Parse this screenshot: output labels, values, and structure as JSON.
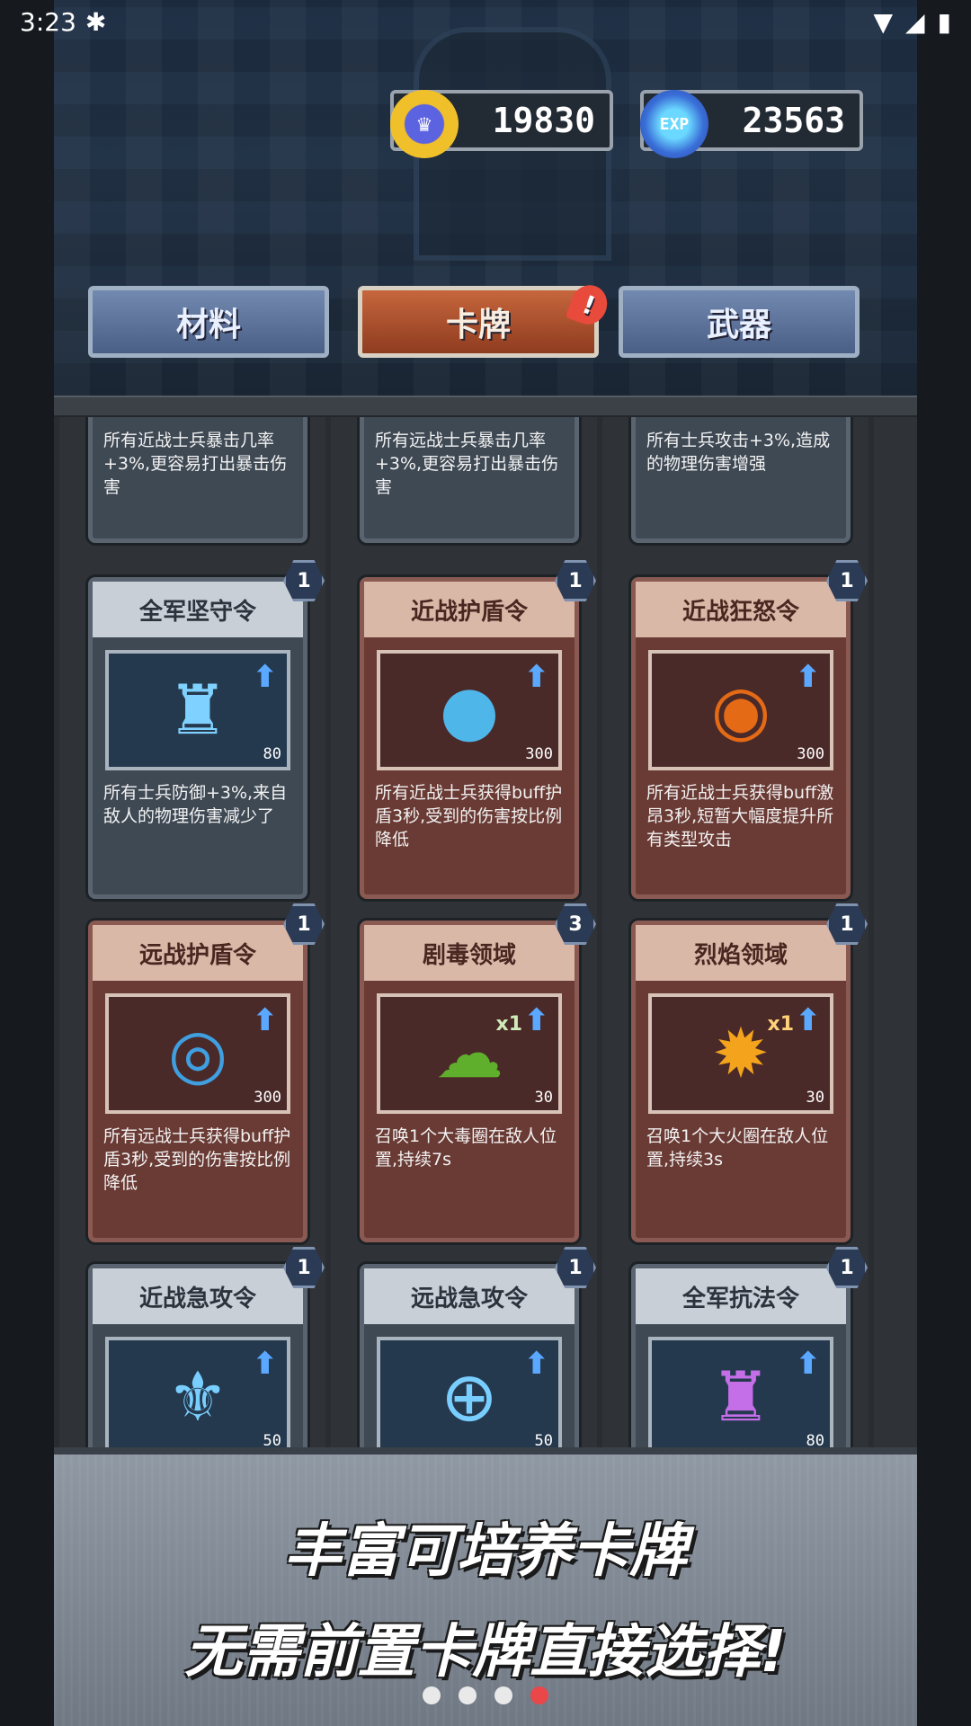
{
  "status_bar": {
    "time": "3:23",
    "app_icon": "bug-icon",
    "wifi": "wifi-icon",
    "signal": "signal-icon",
    "battery": "battery-charging-icon"
  },
  "currency": {
    "gold": {
      "icon": "crown-coin-icon",
      "value": "19830"
    },
    "exp": {
      "icon": "exp-gem-icon",
      "icon_text": "EXP",
      "value": "23563"
    }
  },
  "tabs": [
    {
      "label": "材料",
      "active": false
    },
    {
      "label": "卡牌",
      "active": true,
      "badge": "!"
    },
    {
      "label": "武器",
      "active": false
    }
  ],
  "partial_cards": [
    {
      "desc": "所有近战士兵暴击几率+3%,更容易打出暴击伤害"
    },
    {
      "desc": "所有远战士兵暴击几率+3%,更容易打出暴击伤害"
    },
    {
      "desc": "所有士兵攻击+3%,造成的物理伤害增强"
    }
  ],
  "cards": [
    {
      "title": "全军坚守令",
      "level": "1",
      "power": "80",
      "desc": "所有士兵防御+3%,来自敌人的物理伤害减少了",
      "icon": "soldier-shield-icon",
      "style": "blue"
    },
    {
      "title": "近战护盾令",
      "level": "1",
      "power": "300",
      "desc": "所有近战士兵获得buff护盾3秒,受到的伤害按比例降低",
      "icon": "shield-orb-icon",
      "style": "brown"
    },
    {
      "title": "近战狂怒令",
      "level": "1",
      "power": "300",
      "desc": "所有近战士兵获得buff激昂3秒,短暂大幅度提升所有类型攻击",
      "icon": "rage-arrows-icon",
      "style": "brown"
    },
    {
      "title": "远战护盾令",
      "level": "1",
      "power": "300",
      "desc": "所有远战士兵获得buff护盾3秒,受到的伤害按比例降低",
      "icon": "target-shield-icon",
      "style": "brown"
    },
    {
      "title": "剧毒领域",
      "level": "3",
      "power": "30",
      "mult": "x1",
      "desc": "召唤1个大毒圈在敌人位置,持续7s",
      "icon": "poison-cloud-icon",
      "style": "brown"
    },
    {
      "title": "烈焰领域",
      "level": "1",
      "power": "30",
      "mult": "x1",
      "desc": "召唤1个大火圈在敌人位置,持续3s",
      "icon": "fire-burst-icon",
      "style": "brown"
    },
    {
      "title": "近战急攻令",
      "level": "1",
      "power": "50",
      "desc": "",
      "icon": "wing-badge-icon",
      "style": "blue"
    },
    {
      "title": "远战急攻令",
      "level": "1",
      "power": "50",
      "desc": "",
      "icon": "wing-target-icon",
      "style": "blue"
    },
    {
      "title": "全军抗法令",
      "level": "1",
      "power": "80",
      "desc": "",
      "icon": "magic-resist-icon",
      "style": "blue"
    }
  ],
  "banner": {
    "line1": "丰富可培养卡牌",
    "line2": "无需前置卡牌直接选择!"
  },
  "page_dots": {
    "count": 4,
    "active_index": 3
  }
}
